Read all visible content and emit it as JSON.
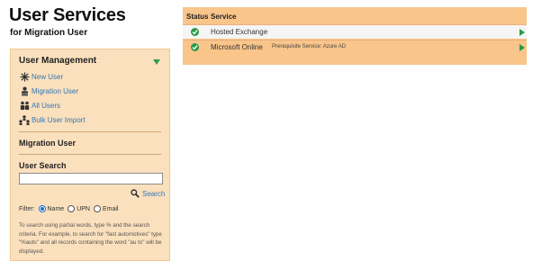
{
  "header": {
    "title": "User Services",
    "subtitle": "for Migration User"
  },
  "sidebar": {
    "section_title": "User Management",
    "items": [
      {
        "label": "New User",
        "icon": "star-burst-icon"
      },
      {
        "label": "Migration User",
        "icon": "user-stack-icon"
      },
      {
        "label": "All Users",
        "icon": "users-group-icon"
      },
      {
        "label": "Bulk User Import",
        "icon": "org-chart-icon"
      }
    ],
    "current_user_label": "Migration User",
    "search": {
      "heading": "User Search",
      "value": "",
      "button_label": "Search"
    },
    "filter": {
      "label": "Filter:",
      "options": [
        "Name",
        "UPN",
        "Email"
      ],
      "selected": "Name"
    },
    "help": "To search using partial words, type % and the search criteria. For example, to search for \"fast automotives\" type \"%auto\" and all records containing the word \"au to\" will be displayed."
  },
  "services_table": {
    "columns": [
      "Status",
      "Service"
    ],
    "rows": [
      {
        "status": "ok",
        "service": "Hosted Exchange",
        "note": ""
      },
      {
        "status": "ok",
        "service": "Microsoft Online",
        "note": "Prerequisite Service: Azure AD"
      }
    ]
  },
  "colors": {
    "panel_bg": "#fbe0bd",
    "table_bg": "#f9c58a",
    "link": "#2f77b9",
    "accent_green": "#2a9a4a"
  }
}
